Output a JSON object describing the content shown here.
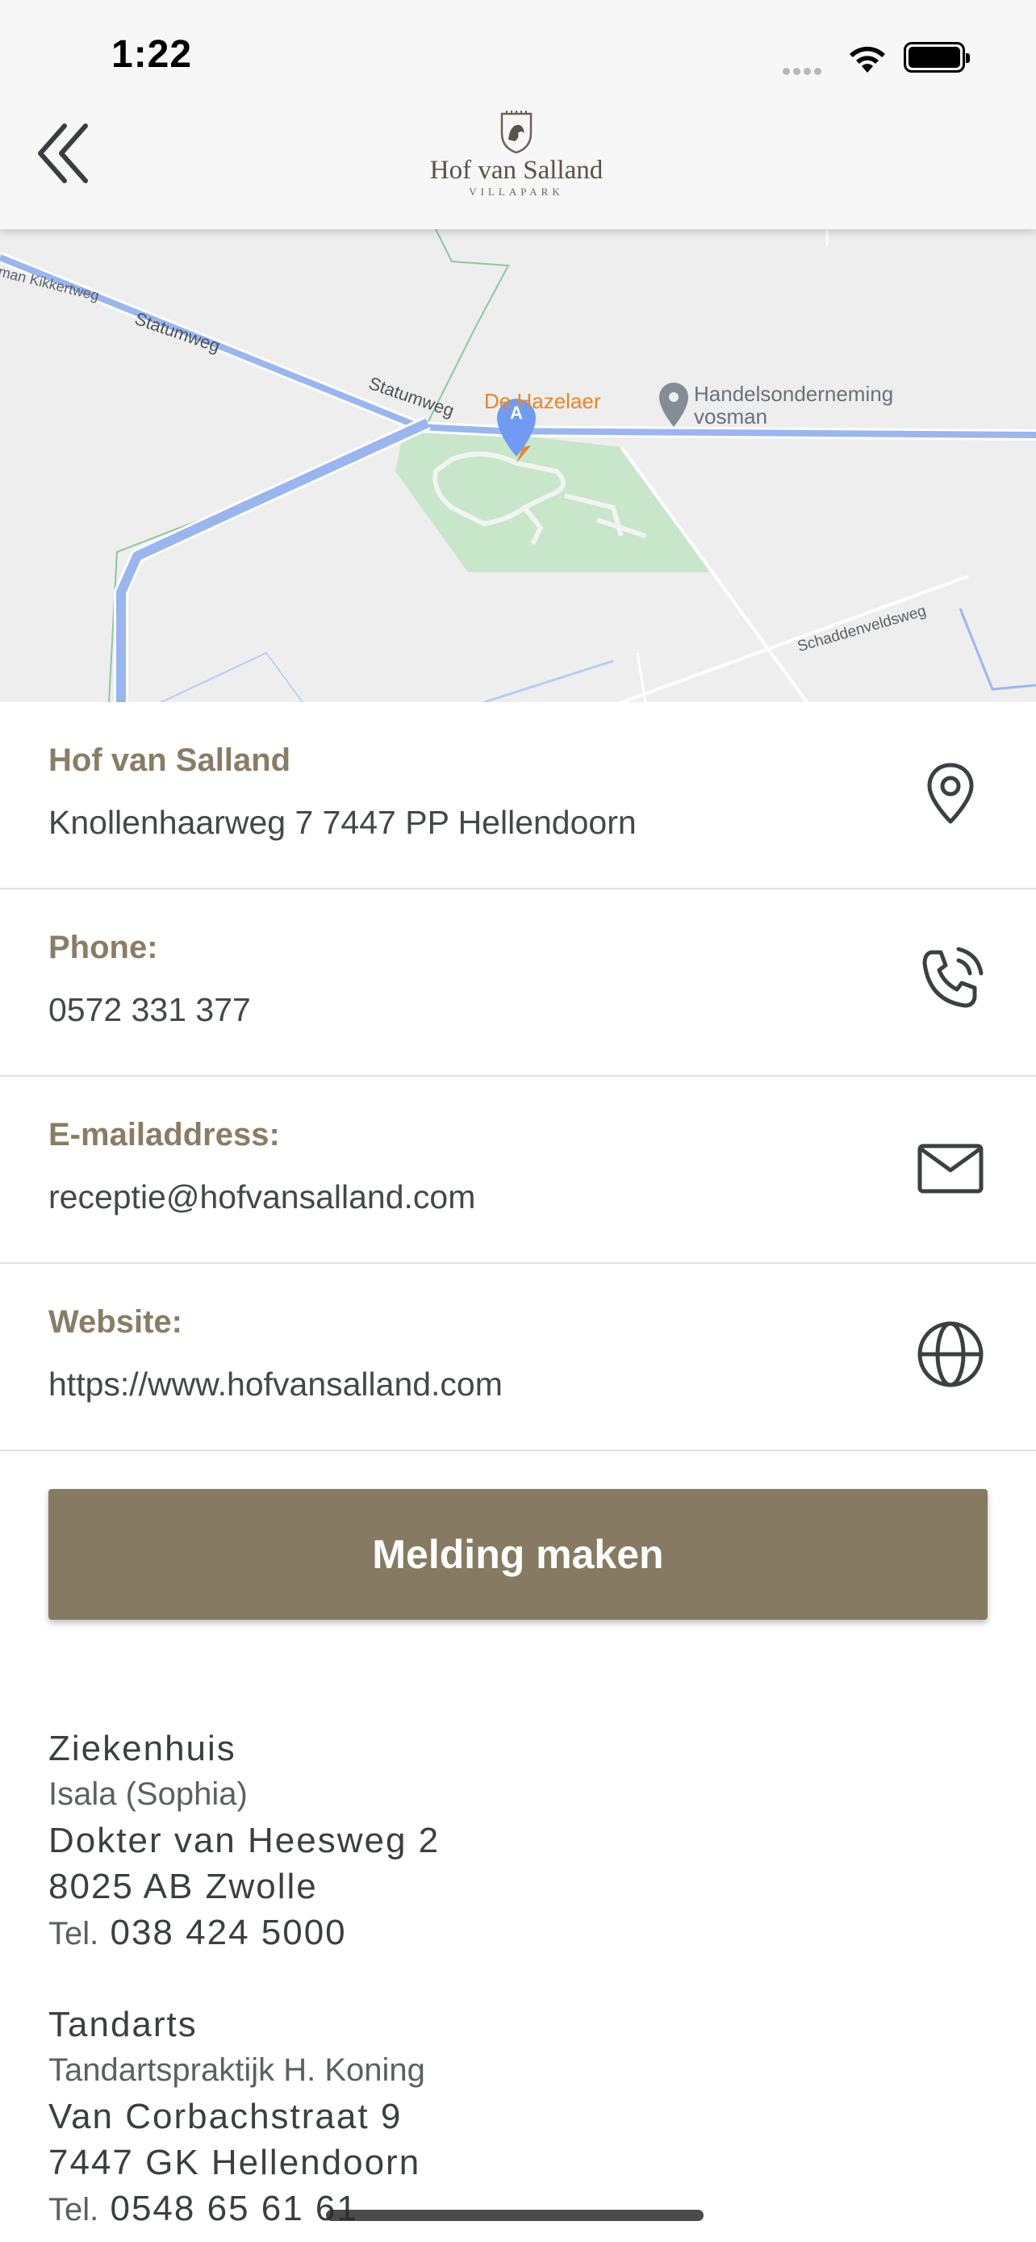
{
  "status_bar": {
    "time": "1:22"
  },
  "header": {
    "back_icon": "double-chevron-left-icon",
    "logo_name": "Hof van Salland",
    "logo_sub": "VILLAPARK"
  },
  "map": {
    "labels": {
      "kikkertweg": "kman Kikkertweg",
      "statumweg_1": "Statumweg",
      "statumweg_2": "Statumweg",
      "poi_orange": "De Hazelaer",
      "poi_grey_1": "Handelsonderneming",
      "poi_grey_2": "vosman",
      "schaddenveldsweg": "Schaddenveldsweg",
      "marker": "A"
    },
    "colors": {
      "road": "#9ab6f0",
      "park": "#c8e6c9",
      "poi_orange": "#e8862a",
      "marker": "#6f9cf2"
    }
  },
  "info": [
    {
      "label": "Hof van Salland",
      "value": "Knollenhaarweg 7 7447 PP  Hellendoorn",
      "icon": "map-pin-icon"
    },
    {
      "label": "Phone:",
      "value": "0572 331 377",
      "icon": "phone-icon"
    },
    {
      "label": "E-mailaddress:",
      "value": "receptie@hofvansalland.com",
      "icon": "mail-icon"
    },
    {
      "label": "Website:",
      "value": "https://www.hofvansalland.com",
      "icon": "globe-icon"
    }
  ],
  "report_button": "Melding maken",
  "contacts": [
    {
      "type": "Ziekenhuis",
      "name": "Isala (Sophia)",
      "street": "Dokter van Heesweg 2",
      "city": "8025 AB  Zwolle",
      "tel_prefix": "Tel.",
      "tel": "038 424 5000"
    },
    {
      "type": "Tandarts",
      "name": "Tandartspraktijk H. Koning",
      "street": "Van Corbachstraat 9",
      "city": "7447 GK Hellendoorn",
      "tel_prefix": "Tel.",
      "tel": "0548 65 61 61"
    }
  ],
  "colors": {
    "accent": "#867a63",
    "label": "#8a7c65",
    "text": "#45484a"
  }
}
